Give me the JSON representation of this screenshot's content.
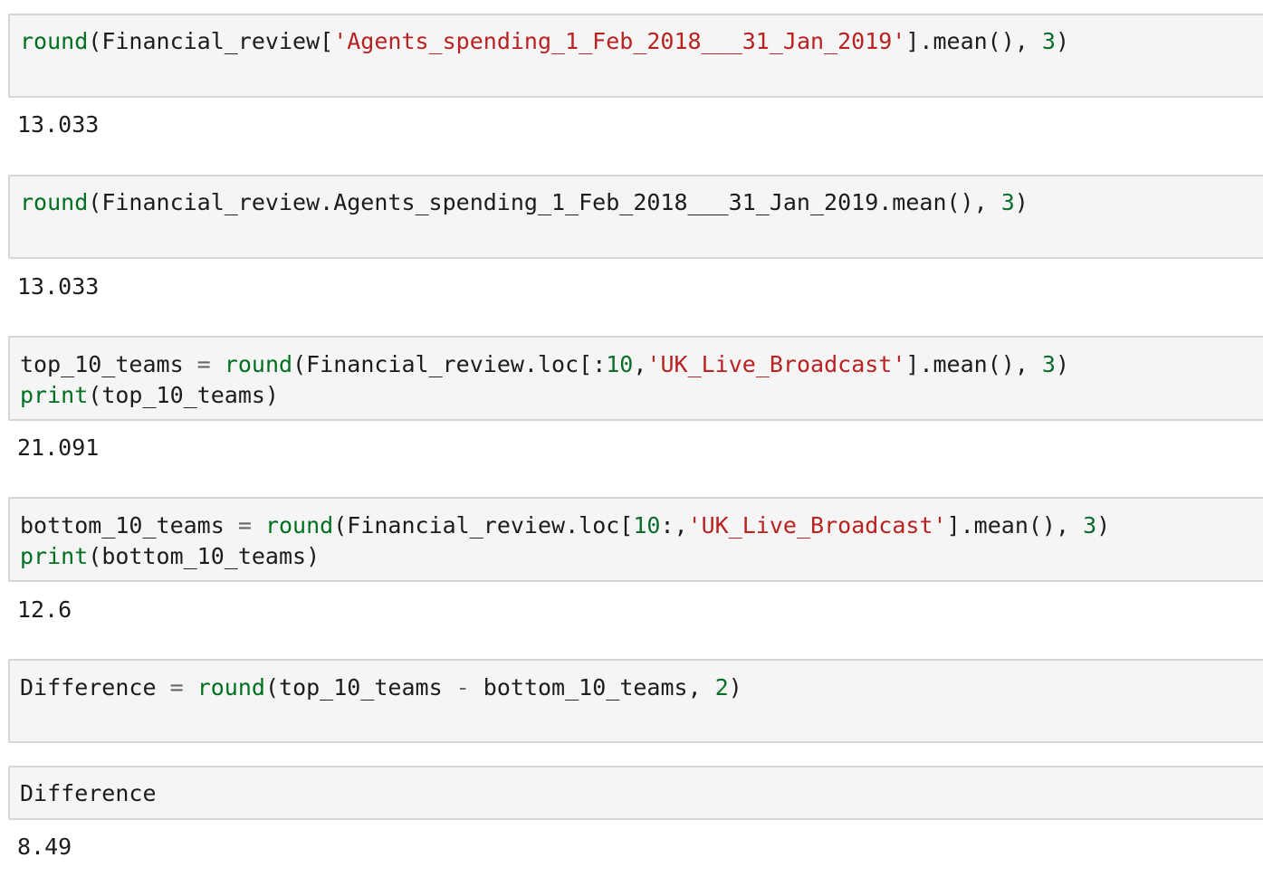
{
  "cells": [
    {
      "code": [
        [
          {
            "t": "round",
            "c": "kw"
          },
          {
            "t": "(Financial_review[",
            "c": "plain"
          },
          {
            "t": "'Agents_spending_1_Feb_2018___31_Jan_2019'",
            "c": "str"
          },
          {
            "t": "].mean(), ",
            "c": "plain"
          },
          {
            "t": "3",
            "c": "num"
          },
          {
            "t": ")",
            "c": "plain"
          }
        ]
      ],
      "output": "13.033"
    },
    {
      "code": [
        [
          {
            "t": "round",
            "c": "kw"
          },
          {
            "t": "(Financial_review.Agents_spending_1_Feb_2018___31_Jan_2019.mean(), ",
            "c": "plain"
          },
          {
            "t": "3",
            "c": "num"
          },
          {
            "t": ")",
            "c": "plain"
          }
        ]
      ],
      "output": "13.033"
    },
    {
      "code": [
        [
          {
            "t": "top_10_teams ",
            "c": "plain"
          },
          {
            "t": "=",
            "c": "op"
          },
          {
            "t": " ",
            "c": "plain"
          },
          {
            "t": "round",
            "c": "kw"
          },
          {
            "t": "(Financial_review.loc[:",
            "c": "plain"
          },
          {
            "t": "10",
            "c": "num"
          },
          {
            "t": ",",
            "c": "plain"
          },
          {
            "t": "'UK_Live_Broadcast'",
            "c": "str"
          },
          {
            "t": "].mean(), ",
            "c": "plain"
          },
          {
            "t": "3",
            "c": "num"
          },
          {
            "t": ")",
            "c": "plain"
          }
        ],
        [
          {
            "t": "print",
            "c": "kw"
          },
          {
            "t": "(top_10_teams)",
            "c": "plain"
          }
        ]
      ],
      "output": "21.091"
    },
    {
      "code": [
        [
          {
            "t": "bottom_10_teams ",
            "c": "plain"
          },
          {
            "t": "=",
            "c": "op"
          },
          {
            "t": " ",
            "c": "plain"
          },
          {
            "t": "round",
            "c": "kw"
          },
          {
            "t": "(Financial_review.loc[",
            "c": "plain"
          },
          {
            "t": "10",
            "c": "num"
          },
          {
            "t": ":,",
            "c": "plain"
          },
          {
            "t": "'UK_Live_Broadcast'",
            "c": "str"
          },
          {
            "t": "].mean(), ",
            "c": "plain"
          },
          {
            "t": "3",
            "c": "num"
          },
          {
            "t": ")",
            "c": "plain"
          }
        ],
        [
          {
            "t": "print",
            "c": "kw"
          },
          {
            "t": "(bottom_10_teams)",
            "c": "plain"
          }
        ]
      ],
      "output": "12.6"
    },
    {
      "code": [
        [
          {
            "t": "Difference ",
            "c": "plain"
          },
          {
            "t": "=",
            "c": "op"
          },
          {
            "t": " ",
            "c": "plain"
          },
          {
            "t": "round",
            "c": "kw"
          },
          {
            "t": "(top_10_teams ",
            "c": "plain"
          },
          {
            "t": "-",
            "c": "op"
          },
          {
            "t": " bottom_10_teams, ",
            "c": "plain"
          },
          {
            "t": "2",
            "c": "num"
          },
          {
            "t": ")",
            "c": "plain"
          }
        ]
      ],
      "output": ""
    },
    {
      "code": [
        [
          {
            "t": "Difference",
            "c": "plain"
          }
        ]
      ],
      "output": "8.49"
    }
  ]
}
